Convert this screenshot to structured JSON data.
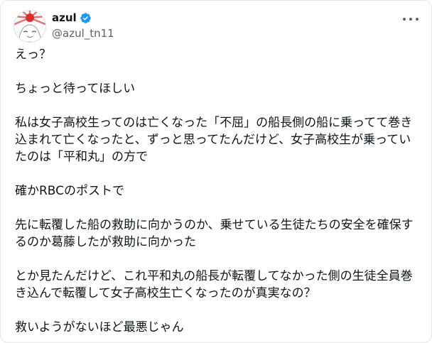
{
  "user": {
    "display_name": "azul",
    "handle": "@azul_tn11",
    "verified_color": "#1d9bf0"
  },
  "icons": {
    "verified": "verified-badge-icon",
    "more": "more-horizontal-icon"
  },
  "tweet": {
    "p1": "えっ？",
    "p2": "ちょっと待ってほしい",
    "p3": "私は女子高校生ってのは亡くなった「不屈」の船長側の船に乗ってて巻き込まれて亡くなったと、ずっと思ってたんだけど、女子高校生が乗っていたのは「平和丸」の方で",
    "p4": "確かRBCのポストで",
    "p5": "先に転覆した船の救助に向かうのか、乗せている生徒たちの安全を確保するのか葛藤したが救助に向かった",
    "p6": "とか見たんだけど、これ平和丸の船長が転覆してなかった側の生徒全員巻き込んで転覆して女子高校生亡くなったのが真実なの？",
    "p7": "救いようがないほど最悪じゃん"
  }
}
